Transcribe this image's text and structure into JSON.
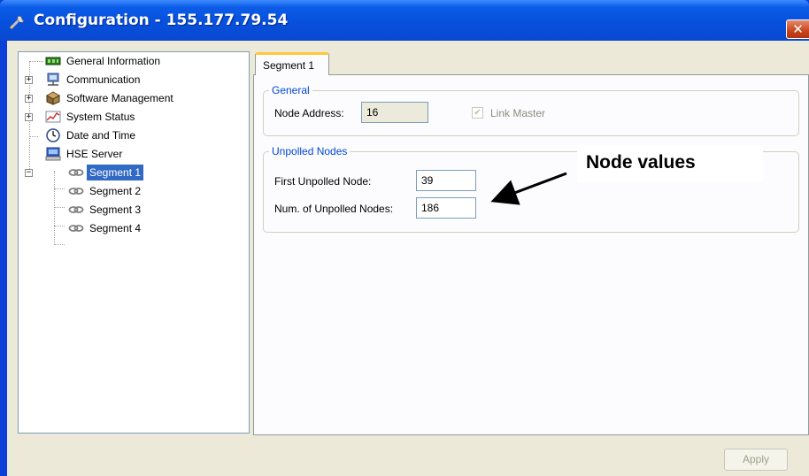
{
  "window": {
    "title": "Configuration - 155.177.79.54",
    "close_label": "✕"
  },
  "tree": {
    "items": [
      {
        "label": "General Information",
        "icon": "general-info-icon",
        "expander": ""
      },
      {
        "label": "Communication",
        "icon": "network-icon",
        "expander": "+"
      },
      {
        "label": "Software Management",
        "icon": "software-box-icon",
        "expander": "+"
      },
      {
        "label": "System Status",
        "icon": "status-chart-icon",
        "expander": "+"
      },
      {
        "label": "Date and Time",
        "icon": "clock-icon",
        "expander": ""
      },
      {
        "label": "HSE Server",
        "icon": "computer-icon",
        "expander": "−"
      },
      {
        "label": "Segment 1",
        "icon": "link-icon",
        "selected": true
      },
      {
        "label": "Segment 2",
        "icon": "link-icon"
      },
      {
        "label": "Segment 3",
        "icon": "link-icon"
      },
      {
        "label": "Segment 4",
        "icon": "link-icon"
      }
    ]
  },
  "tabs": [
    {
      "label": "Segment 1",
      "active": true
    }
  ],
  "general": {
    "title": "General",
    "node_address_label": "Node Address:",
    "node_address_value": "16",
    "link_master_label": "Link Master",
    "link_master_checked": true
  },
  "unpolled": {
    "title": "Unpolled Nodes",
    "first_label": "First Unpolled Node:",
    "first_value": "39",
    "num_label": "Num. of Unpolled Nodes:",
    "num_value": "186"
  },
  "annotation": {
    "text": "Node values"
  },
  "footer": {
    "apply_label": "Apply"
  },
  "colors": {
    "titlebar": "#0750dd",
    "selection": "#316ac5",
    "group_title": "#0046d5",
    "tab_highlight": "#ffc83c"
  }
}
